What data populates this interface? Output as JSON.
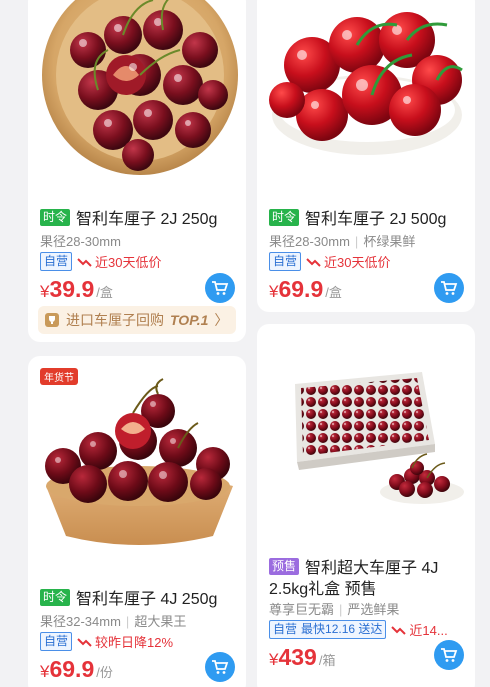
{
  "products": [
    {
      "tag": "时令",
      "title": "智利车厘子 2J 250g",
      "spec": "果径28-30mm",
      "spec2": "",
      "self": "自营",
      "promo": "近30天低价",
      "currency": "¥",
      "price": "39.9",
      "unit": "/盒",
      "rank_text": "进口车厘子回购",
      "rank_top": "TOP.1",
      "rank_arrow": "〉"
    },
    {
      "tag": "时令",
      "title": "智利车厘子 2J 500g",
      "spec": "果径28-30mm",
      "spec2": "杯绿果鲜",
      "self": "自营",
      "promo": "近30天低价",
      "currency": "¥",
      "price": "69.9",
      "unit": "/盒"
    },
    {
      "badge": "年货节",
      "tag": "时令",
      "title": "智利车厘子 4J 250g",
      "spec": "果径32-34mm",
      "spec2": "超大果王",
      "self": "自营",
      "promo": "较昨日降12%",
      "currency": "¥",
      "price": "69.9",
      "unit": "/份"
    },
    {
      "tag": "预售",
      "title": "智利超大车厘子 4J",
      "title_line2": "2.5kg礼盒 预售",
      "spec": "尊享巨无霸",
      "spec2": "严选鲜果",
      "self": "自营",
      "delivery": "最快12.16 送达",
      "promo": "近14...",
      "currency": "¥",
      "price": "439",
      "unit": "/箱"
    }
  ],
  "colors": {
    "price": "#e5333a",
    "tag_green": "#27b34b",
    "tag_purple": "#9b6cdf",
    "cart": "#2f9bf1",
    "self_blue": "#2a6fd2"
  }
}
